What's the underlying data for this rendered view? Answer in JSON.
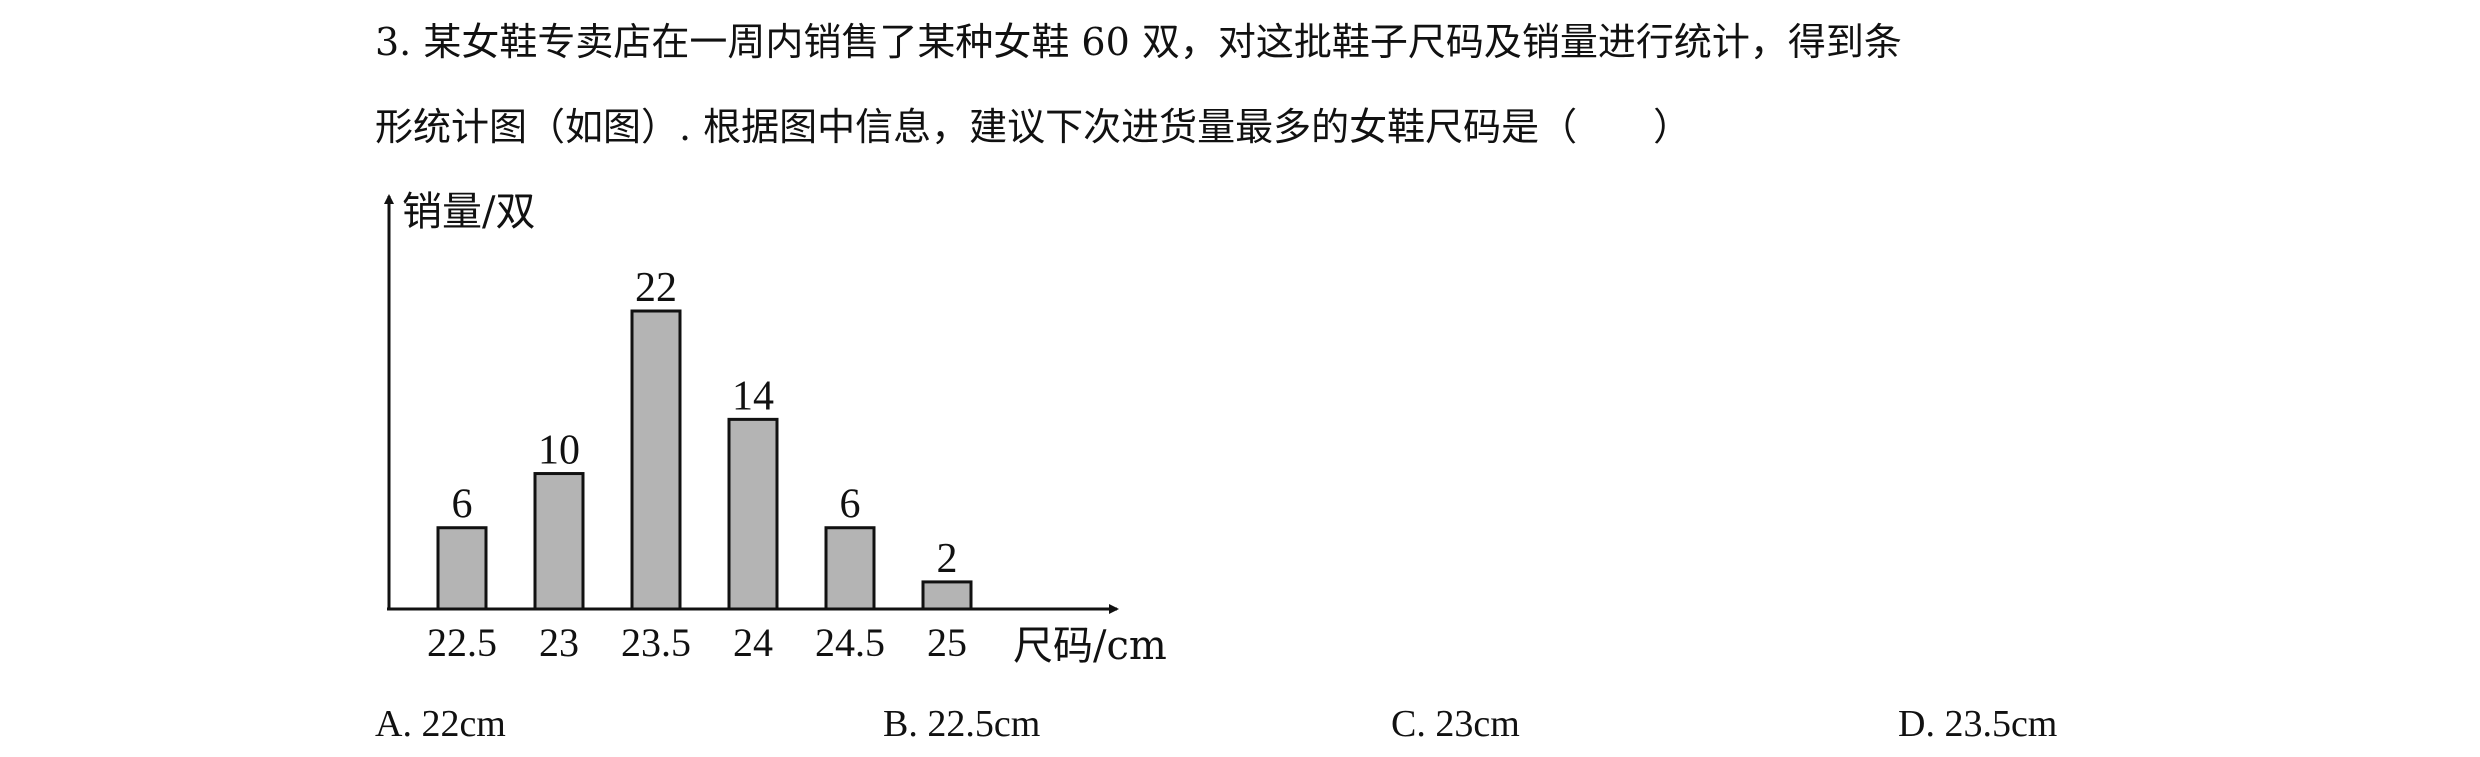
{
  "question": {
    "line1": "3. 某女鞋专卖店在一周内销售了某种女鞋 60 双，对这批鞋子尺码及销量进行统计，得到条",
    "line2": "形统计图（如图）. 根据图中信息，建议下次进货量最多的女鞋尺码是（　　）"
  },
  "chart_data": {
    "type": "bar",
    "categories": [
      "22.5",
      "23",
      "23.5",
      "24",
      "24.5",
      "25"
    ],
    "values": [
      6,
      10,
      22,
      14,
      6,
      2
    ],
    "xlabel": "尺码/cm",
    "ylabel": "销量/双",
    "ylim": [
      0,
      22
    ],
    "grid": false,
    "bar_color": "#b4b4b4",
    "bar_stroke": "#111111"
  },
  "options": {
    "a": "A. 22cm",
    "b": "B. 22.5cm",
    "c": "C. 23cm",
    "d": "D. 23.5cm"
  }
}
